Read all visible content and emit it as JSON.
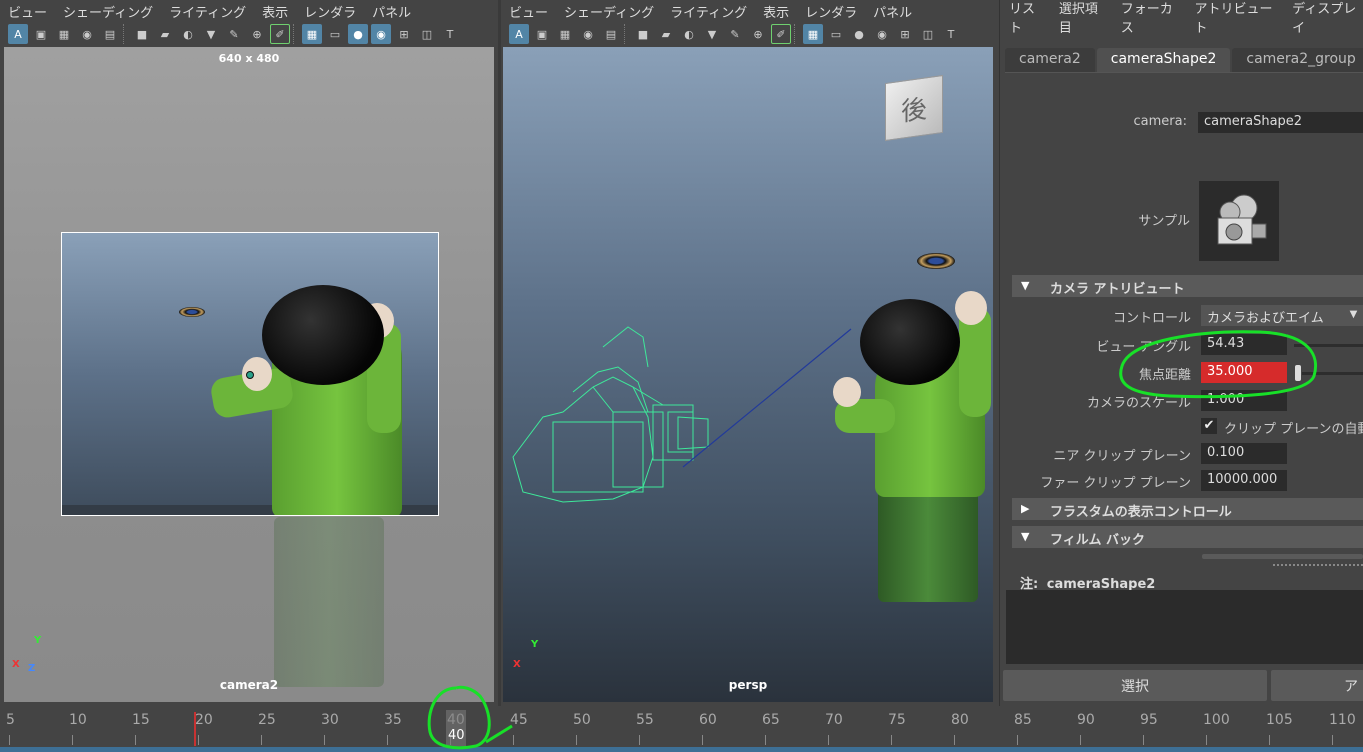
{
  "viewport_menu": [
    "ビュー",
    "シェーディング",
    "ライティング",
    "表示",
    "レンダラ",
    "パネル"
  ],
  "left_viewport": {
    "resolution": "640 x 480",
    "camera_name": "camera2"
  },
  "right_viewport": {
    "camera_name": "persp",
    "viewcube_label": "後"
  },
  "attribute_editor": {
    "menu": [
      "リスト",
      "選択項目",
      "フォーカス",
      "アトリビュート",
      "ディスプレイ"
    ],
    "tabs": [
      "camera2",
      "cameraShape2",
      "camera2_group"
    ],
    "active_tab": "cameraShape2",
    "camera_label": "camera:",
    "camera_value": "cameraShape2",
    "sample_label": "サンプル",
    "section_camera": "カメラ アトリビュート",
    "control_label": "コントロール",
    "control_value": "カメラおよびエイム",
    "view_angle_label": "ビュー アングル",
    "view_angle_value": "54.43",
    "focal_label": "焦点距離",
    "focal_value": "35.000",
    "camera_scale_label": "カメラのスケール",
    "camera_scale_value": "1.000",
    "auto_clip_label": "クリップ プレーンの自動レンダー",
    "near_clip_label": "ニア クリップ プレーン",
    "near_clip_value": "0.100",
    "far_clip_label": "ファー クリップ プレーン",
    "far_clip_value": "10000.000",
    "section_frustum": "フラスタムの表示コントロール",
    "section_film": "フィルム バック",
    "notes_label": "注:",
    "notes_value": "cameraShape2",
    "select_button": "選択",
    "load_button": "ア"
  },
  "timeline": {
    "labels": [
      "5",
      "10",
      "15",
      "20",
      "25",
      "30",
      "35",
      "40",
      "45",
      "50",
      "55",
      "60",
      "65",
      "70",
      "75",
      "80",
      "85",
      "90",
      "95",
      "100",
      "105",
      "110"
    ],
    "current_frame": "40"
  },
  "colors": {
    "focal_field_bg": "#d62b2b",
    "annotation": "#18e028",
    "wireframe": "#3ee89a"
  }
}
